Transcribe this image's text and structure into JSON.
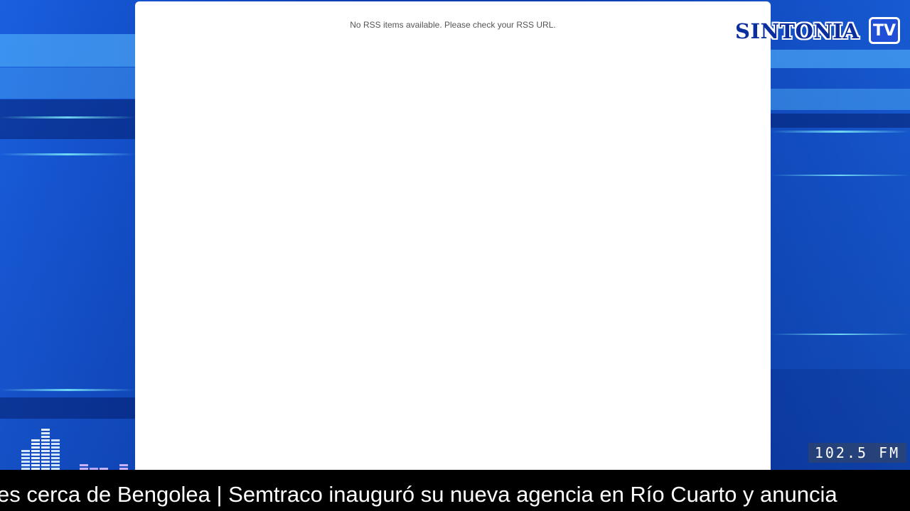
{
  "rss_panel": {
    "message": "No RSS items available. Please check your RSS URL."
  },
  "branding": {
    "logo_word": "SINTONIA",
    "logo_badge": "TV",
    "frequency": "102.5 FM"
  },
  "ticker": {
    "text": "es cerca de Bengolea | Semtraco inauguró su nueva agencia en Río Cuarto y anuncia"
  },
  "colors": {
    "background_blue": "#0b3fb5",
    "panel_white": "#ffffff",
    "ticker_black": "#000000",
    "logo_navy": "#0b2e9e"
  },
  "icons": {
    "equalizer": "equalizer-icon",
    "logo_tv": "tv-badge-icon"
  }
}
